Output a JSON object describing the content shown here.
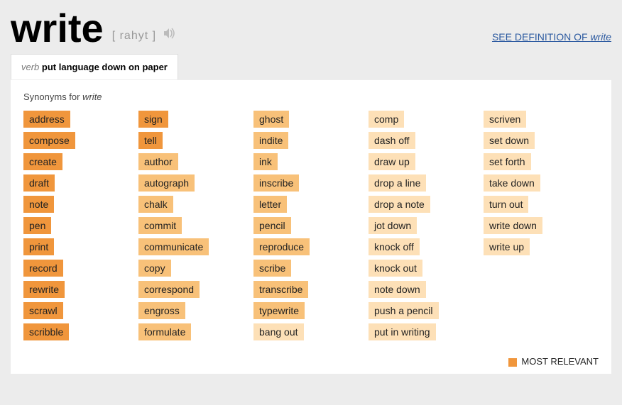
{
  "headword": "write",
  "pronunciation": "[ rahyt ]",
  "definition_link": {
    "prefix": "SEE DEFINITION OF ",
    "word": "write"
  },
  "tab": {
    "pos": "verb",
    "definition": "put language down on paper"
  },
  "synonyms_heading": {
    "prefix": "Synonyms for ",
    "word": "write"
  },
  "columns": [
    [
      {
        "word": "address",
        "shade": 1
      },
      {
        "word": "compose",
        "shade": 1
      },
      {
        "word": "create",
        "shade": 1
      },
      {
        "word": "draft",
        "shade": 1
      },
      {
        "word": "note",
        "shade": 1
      },
      {
        "word": "pen",
        "shade": 1
      },
      {
        "word": "print",
        "shade": 1
      },
      {
        "word": "record",
        "shade": 1
      },
      {
        "word": "rewrite",
        "shade": 1
      },
      {
        "word": "scrawl",
        "shade": 1
      },
      {
        "word": "scribble",
        "shade": 1
      }
    ],
    [
      {
        "word": "sign",
        "shade": 1
      },
      {
        "word": "tell",
        "shade": 1
      },
      {
        "word": "author",
        "shade": 2
      },
      {
        "word": "autograph",
        "shade": 2
      },
      {
        "word": "chalk",
        "shade": 2
      },
      {
        "word": "commit",
        "shade": 2
      },
      {
        "word": "communicate",
        "shade": 2
      },
      {
        "word": "copy",
        "shade": 2
      },
      {
        "word": "correspond",
        "shade": 2
      },
      {
        "word": "engross",
        "shade": 2
      },
      {
        "word": "formulate",
        "shade": 2
      }
    ],
    [
      {
        "word": "ghost",
        "shade": 2
      },
      {
        "word": "indite",
        "shade": 2
      },
      {
        "word": "ink",
        "shade": 2
      },
      {
        "word": "inscribe",
        "shade": 2
      },
      {
        "word": "letter",
        "shade": 2
      },
      {
        "word": "pencil",
        "shade": 2
      },
      {
        "word": "reproduce",
        "shade": 2
      },
      {
        "word": "scribe",
        "shade": 2
      },
      {
        "word": "transcribe",
        "shade": 2
      },
      {
        "word": "typewrite",
        "shade": 2
      },
      {
        "word": "bang out",
        "shade": 3
      }
    ],
    [
      {
        "word": "comp",
        "shade": 3
      },
      {
        "word": "dash off",
        "shade": 3
      },
      {
        "word": "draw up",
        "shade": 3
      },
      {
        "word": "drop a line",
        "shade": 3
      },
      {
        "word": "drop a note",
        "shade": 3
      },
      {
        "word": "jot down",
        "shade": 3
      },
      {
        "word": "knock off",
        "shade": 3
      },
      {
        "word": "knock out",
        "shade": 3
      },
      {
        "word": "note down",
        "shade": 3
      },
      {
        "word": "push a pencil",
        "shade": 3
      },
      {
        "word": "put in writing",
        "shade": 3
      }
    ],
    [
      {
        "word": "scriven",
        "shade": 3
      },
      {
        "word": "set down",
        "shade": 3
      },
      {
        "word": "set forth",
        "shade": 3
      },
      {
        "word": "take down",
        "shade": 3
      },
      {
        "word": "turn out",
        "shade": 3
      },
      {
        "word": "write down",
        "shade": 3
      },
      {
        "word": "write up",
        "shade": 3
      }
    ]
  ],
  "legend": {
    "label": "MOST RELEVANT",
    "color": "#f0963c"
  }
}
